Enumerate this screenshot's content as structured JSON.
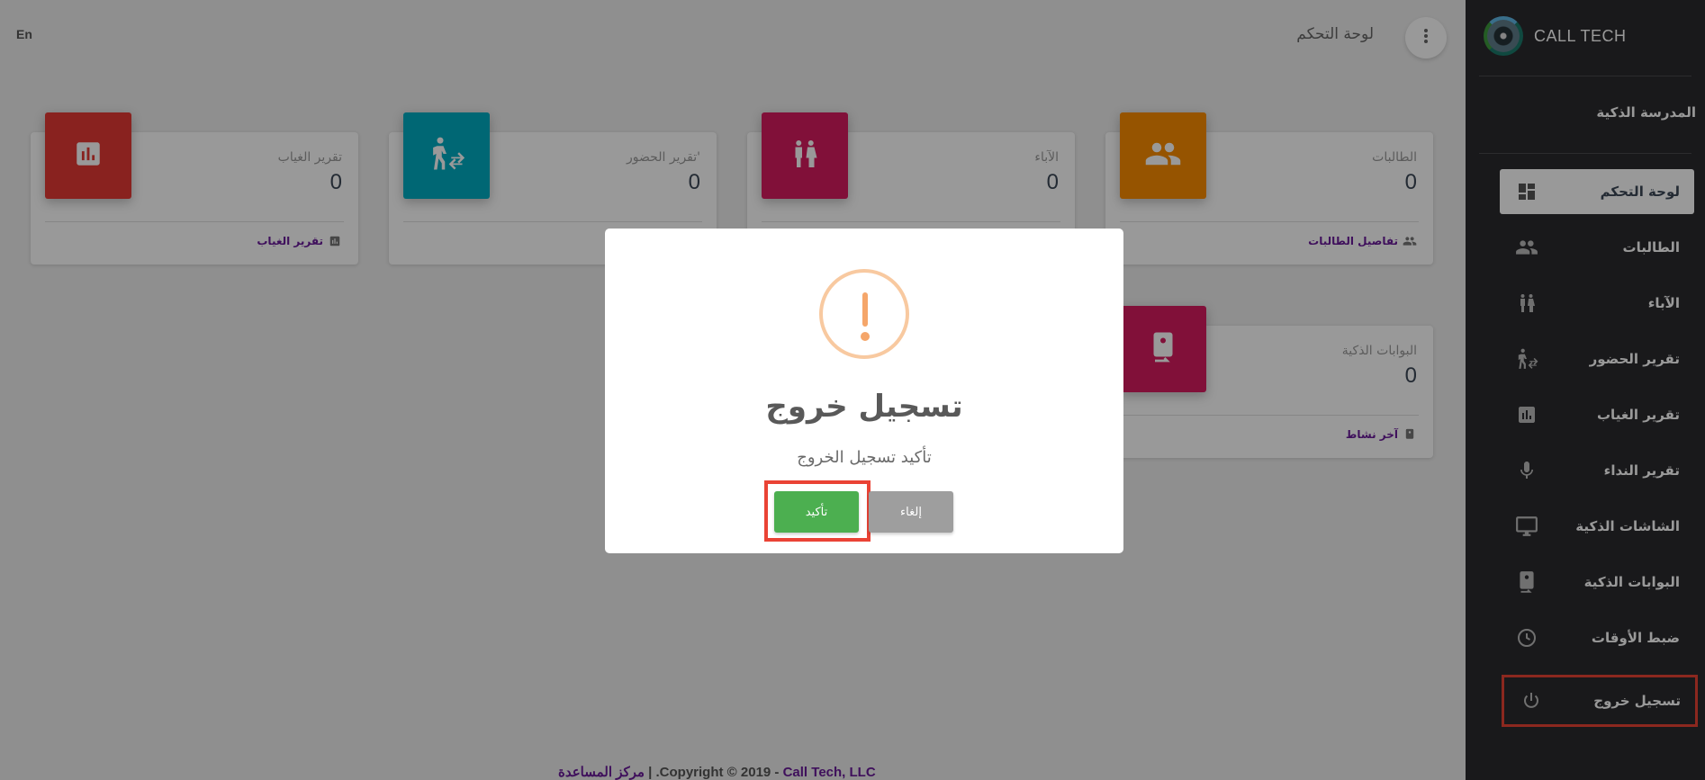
{
  "app": {
    "brand_name": "CALL TECH",
    "school_name": "المدرسة الذكية",
    "language_toggle": "En"
  },
  "topbar": {
    "title": "لوحة التحكم"
  },
  "sidebar": {
    "items": [
      {
        "label": "لوحة التحكم",
        "icon": "dashboard-icon",
        "active": true
      },
      {
        "label": "الطالبات",
        "icon": "people-icon"
      },
      {
        "label": "الآباء",
        "icon": "parents-icon"
      },
      {
        "label": "تقرير الحضور",
        "icon": "attendance-icon"
      },
      {
        "label": "تقرير الغياب",
        "icon": "bar-chart-icon"
      },
      {
        "label": "تقرير النداء",
        "icon": "microphone-icon"
      },
      {
        "label": "الشاشات الذكية",
        "icon": "monitor-icon"
      },
      {
        "label": "البوابات الذكية",
        "icon": "gate-icon"
      },
      {
        "label": "ضبط الأوقات",
        "icon": "clock-icon"
      },
      {
        "label": "تسجيل خروج",
        "icon": "power-icon"
      }
    ]
  },
  "cards": [
    {
      "title": "الطالبات",
      "value": "0",
      "footer": "تفاصيل الطالبات",
      "color": "#fb8c00",
      "icon": "people-icon"
    },
    {
      "title": "الآباء",
      "value": "0",
      "footer": "",
      "color": "#d81b60",
      "icon": "parents-icon"
    },
    {
      "title": "'تقرير الحضور",
      "value": "0",
      "footer": "",
      "color": "#00acc1",
      "icon": "attendance-icon"
    },
    {
      "title": "تقرير الغياب",
      "value": "0",
      "footer": "تقرير الغياب",
      "color": "#e53935",
      "icon": "bar-chart-icon"
    },
    {
      "title": "البوابات الذكية",
      "value": "0",
      "footer": "آخر نشاط",
      "color": "#d81b60",
      "icon": "gate-icon"
    }
  ],
  "footer": {
    "help_link": "مركز المساعدة",
    "separator": " | ",
    "copyright": ".Copyright © 2019 - ",
    "company": "Call Tech, LLC"
  },
  "modal": {
    "title": "تسجيل خروج",
    "text": "تأكيد تسجيل الخروج",
    "confirm_label": "تأكيد",
    "cancel_label": "إلغاء",
    "warning_color": "#f8bb86",
    "confirm_color": "#4caf50",
    "cancel_color": "#9e9e9e"
  }
}
